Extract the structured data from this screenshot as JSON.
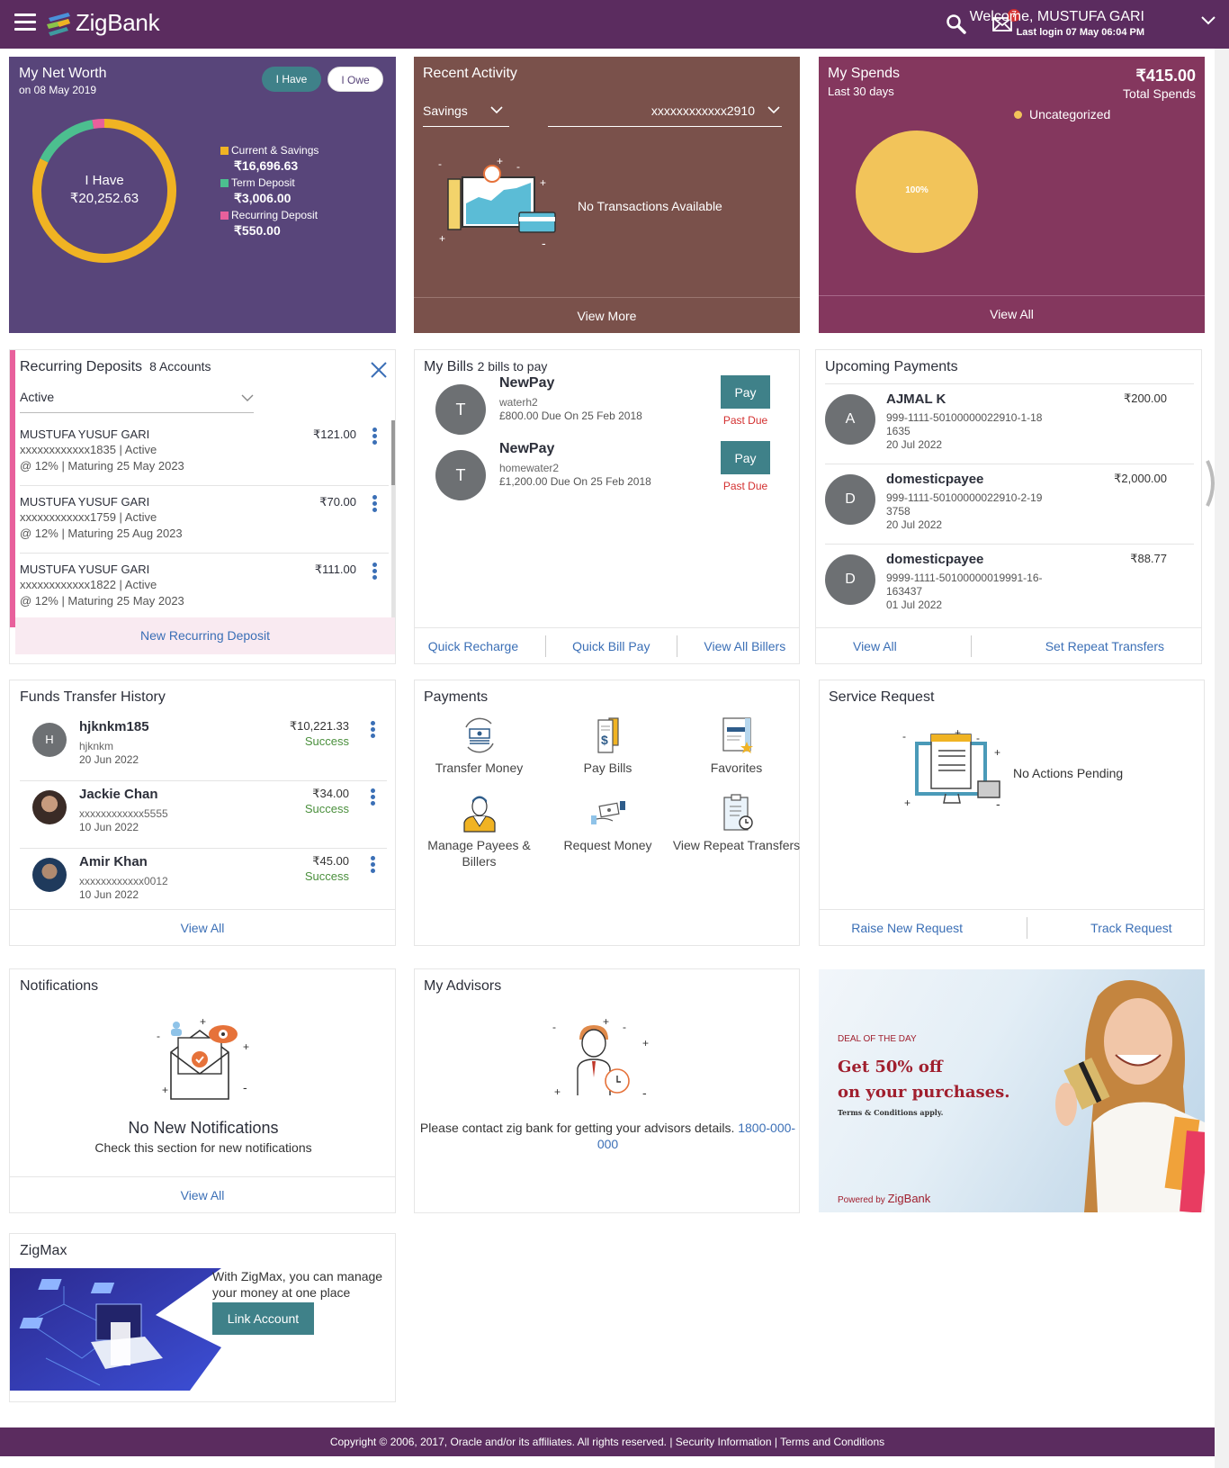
{
  "header": {
    "brand": "ZigBank",
    "welcome": "Welcome, MUSTUFA GARI",
    "last_login": "Last login 07 May 06:04 PM",
    "mail_badge": "7",
    "icons": [
      "menu-icon",
      "zigbank-logo",
      "search-icon",
      "mail-icon",
      "chevron-down-icon"
    ]
  },
  "net_worth": {
    "title": "My Net Worth",
    "subtitle": "on 08 May 2019",
    "toggle_have": "I Have",
    "toggle_owe": "I Owe",
    "center_label": "I Have",
    "center_value": "₹20,252.63",
    "legend": [
      {
        "name": "Current & Savings",
        "value": "₹16,696.63",
        "amount": 16696.63,
        "color": "#f0b323"
      },
      {
        "name": "Term Deposit",
        "value": "₹3,006.00",
        "amount": 3006.0,
        "color": "#4cbf8f"
      },
      {
        "name": "Recurring Deposit",
        "value": "₹550.00",
        "amount": 550.0,
        "color": "#e8609c"
      }
    ]
  },
  "recent_activity": {
    "title": "Recent Activity",
    "account_type": "Savings",
    "account_number": "xxxxxxxxxxxx2910",
    "empty_message": "No Transactions Available",
    "footer_link": "View More"
  },
  "my_spends": {
    "title": "My Spends",
    "subtitle": "Last 30 days",
    "total": "₹415.00",
    "total_label": "Total Spends",
    "legend": [
      {
        "name": "Uncategorized",
        "percent": 100,
        "color": "#f2c45a"
      }
    ],
    "pie_label": "100%",
    "footer_link": "View All"
  },
  "recurring_deposits": {
    "title": "Recurring Deposits",
    "count": "8 Accounts",
    "filter": "Active",
    "items": [
      {
        "name": "MUSTUFA YUSUF GARI",
        "account": "xxxxxxxxxxxx1835 | Active",
        "details": "@ 12% | Maturing 25 May 2023",
        "amount": "₹121.00"
      },
      {
        "name": "MUSTUFA YUSUF GARI",
        "account": "xxxxxxxxxxxx1759 | Active",
        "details": "@ 12% | Maturing 25 Aug 2023",
        "amount": "₹70.00"
      },
      {
        "name": "MUSTUFA YUSUF GARI",
        "account": "xxxxxxxxxxxx1822 | Active",
        "details": "@ 12% | Maturing 25 May 2023",
        "amount": "₹111.00"
      }
    ],
    "new_link": "New Recurring Deposit"
  },
  "my_bills": {
    "title": "My Bills",
    "subtitle": "2 bills to pay",
    "items": [
      {
        "initial": "T",
        "biller": "NewPay",
        "nickname": "waterh2",
        "due": "£800.00 Due On 25 Feb 2018",
        "pay_label": "Pay",
        "status": "Past Due"
      },
      {
        "initial": "T",
        "biller": "NewPay",
        "nickname": "homewater2",
        "due": "£1,200.00 Due On 25 Feb 2018",
        "pay_label": "Pay",
        "status": "Past Due"
      }
    ],
    "links": [
      "Quick Recharge",
      "Quick Bill Pay",
      "View All Billers"
    ]
  },
  "upcoming_payments": {
    "title": "Upcoming Payments",
    "items": [
      {
        "initial": "A",
        "name": "AJMAL K",
        "account": "999-1111-50100000022910-1-181635",
        "date": "20 Jul 2022",
        "amount": "₹200.00"
      },
      {
        "initial": "D",
        "name": "domesticpayee",
        "account": "999-1111-50100000022910-2-193758",
        "date": "20 Jul 2022",
        "amount": "₹2,000.00"
      },
      {
        "initial": "D",
        "name": "domesticpayee",
        "account": "9999-1111-50100000019991-16-163437",
        "date": "01 Jul 2022",
        "amount": "₹88.77"
      }
    ],
    "links": [
      "View All",
      "Set Repeat Transfers"
    ]
  },
  "funds_transfer": {
    "title": "Funds Transfer History",
    "items": [
      {
        "initial": "H",
        "name": "hjknkm185",
        "account": "hjknkm",
        "date": "20 Jun 2022",
        "amount": "₹10,221.33",
        "status": "Success"
      },
      {
        "initial": "",
        "name": "Jackie Chan",
        "account": "xxxxxxxxxxxx5555",
        "date": "10 Jun 2022",
        "amount": "₹34.00",
        "status": "Success"
      },
      {
        "initial": "",
        "name": "Amir Khan",
        "account": "xxxxxxxxxxxx0012",
        "date": "10 Jun 2022",
        "amount": "₹45.00",
        "status": "Success"
      }
    ],
    "footer_link": "View All"
  },
  "payments": {
    "title": "Payments",
    "tiles": [
      {
        "label": "Transfer Money",
        "icon": "transfer-money-icon"
      },
      {
        "label": "Pay Bills",
        "icon": "pay-bills-icon"
      },
      {
        "label": "Favorites",
        "icon": "favorites-icon"
      },
      {
        "label": "Manage Payees & Billers",
        "icon": "manage-payees-icon"
      },
      {
        "label": "Request Money",
        "icon": "request-money-icon"
      },
      {
        "label": "View Repeat Transfers",
        "icon": "repeat-transfers-icon"
      }
    ]
  },
  "service_request": {
    "title": "Service Request",
    "empty_message": "No Actions Pending",
    "links": [
      "Raise New Request",
      "Track Request"
    ]
  },
  "notifications": {
    "title": "Notifications",
    "heading": "No New Notifications",
    "subtext": "Check this section for new notifications",
    "footer_link": "View All"
  },
  "advisors": {
    "title": "My Advisors",
    "message": "Please contact zig bank for getting your advisors details.",
    "phone": "1800-000-000"
  },
  "promo": {
    "tag": "DEAL OF THE DAY",
    "headline1": "Get 50% off",
    "headline2": "on your purchases.",
    "terms": "Terms & Conditions apply.",
    "powered_prefix": "Powered by",
    "powered_brand": "ZigBank"
  },
  "zigmax": {
    "title": "ZigMax",
    "text": "With ZigMax, you can manage your money at one place",
    "button": "Link Account"
  },
  "footer": {
    "copyright": "Copyright © 2006, 2017, Oracle and/or its affiliates. All rights reserved.",
    "security": "Security Information",
    "terms": "Terms and Conditions"
  }
}
